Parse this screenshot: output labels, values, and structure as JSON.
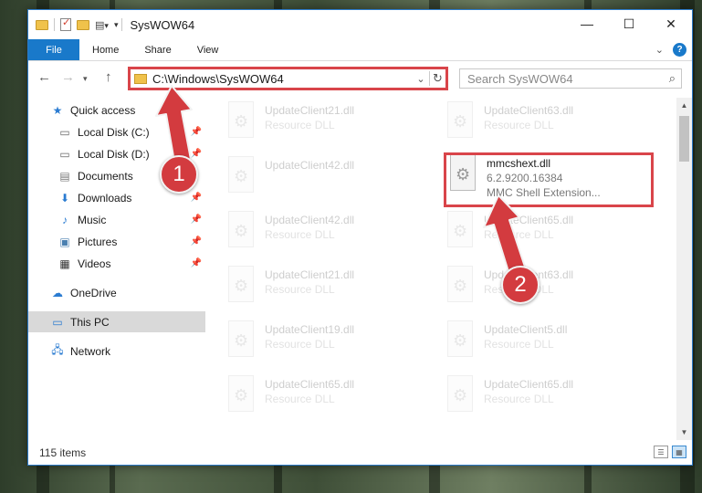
{
  "window": {
    "title": "SysWOW64",
    "controls": [
      "—",
      "☐",
      "✕"
    ]
  },
  "ribbon": {
    "tabs": [
      "File",
      "Home",
      "Share",
      "View"
    ]
  },
  "nav": {
    "address_path": "C:\\Windows\\SysWOW64",
    "search_placeholder": "Search SysWOW64"
  },
  "sidebar": {
    "items": [
      {
        "label": "Quick access",
        "icon": "star-icon",
        "pinned": false
      },
      {
        "label": "Local Disk (C:)",
        "icon": "drive-icon",
        "pinned": true
      },
      {
        "label": "Local Disk (D:)",
        "icon": "drive-icon",
        "pinned": true
      },
      {
        "label": "Documents",
        "icon": "documents-icon",
        "pinned": true
      },
      {
        "label": "Downloads",
        "icon": "download-icon",
        "pinned": true
      },
      {
        "label": "Music",
        "icon": "music-icon",
        "pinned": true
      },
      {
        "label": "Pictures",
        "icon": "pictures-icon",
        "pinned": true
      },
      {
        "label": "Videos",
        "icon": "videos-icon",
        "pinned": true
      },
      {
        "label": "OneDrive",
        "icon": "cloud-icon",
        "pinned": false
      },
      {
        "label": "This PC",
        "icon": "computer-icon",
        "pinned": false,
        "selected": true
      },
      {
        "label": "Network",
        "icon": "network-icon",
        "pinned": false
      }
    ]
  },
  "files": {
    "left": [
      {
        "name": "UpdateClient21.dll",
        "meta": "Resource DLL"
      },
      {
        "name": "UpdateClient42.dll",
        "meta": ""
      },
      {
        "name": "UpdateClient42.dll",
        "meta": "Resource DLL"
      },
      {
        "name": "UpdateClient21.dll",
        "meta": "Resource DLL"
      },
      {
        "name": "UpdateClient19.dll",
        "meta": "Resource DLL"
      },
      {
        "name": "UpdateClient65.dll",
        "meta": "Resource DLL"
      }
    ],
    "right": [
      {
        "name": "UpdateClient63.dll",
        "meta": "Resource DLL"
      },
      {
        "name": "UpdateClient65.dll",
        "meta": "Resource DLL"
      },
      {
        "name": "UpdateClient63.dll",
        "meta": "Resource DLL"
      },
      {
        "name": "UpdateClient5.dll",
        "meta": "Resource DLL"
      },
      {
        "name": "UpdateClient65.dll",
        "meta": "Resource DLL"
      }
    ],
    "highlighted": {
      "name": "mmcshext.dll",
      "version": "6.2.9200.16384",
      "description": "MMC Shell Extension..."
    }
  },
  "status": {
    "item_count": "115 items"
  },
  "callouts": [
    "1",
    "2"
  ],
  "colors": {
    "accent": "#1979ca",
    "callout_red": "#d33b3f"
  }
}
